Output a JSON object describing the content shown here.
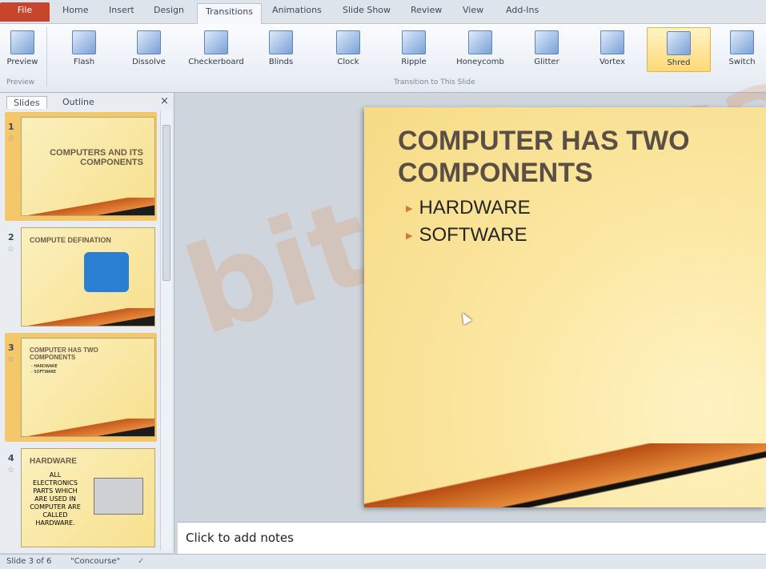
{
  "tabs": [
    "File",
    "Home",
    "Insert",
    "Design",
    "Transitions",
    "Animations",
    "Slide Show",
    "Review",
    "View",
    "Add-Ins"
  ],
  "active_tab": "Transitions",
  "ribbon": {
    "preview_label": "Preview",
    "preview_group": "Preview",
    "transition_group": "Transition to This Slide",
    "transitions": [
      "Flash",
      "Dissolve",
      "Checkerboard",
      "Blinds",
      "Clock",
      "Ripple",
      "Honeycomb",
      "Glitter",
      "Vortex",
      "Shred",
      "Switch"
    ],
    "selected_transition": "Shred"
  },
  "pane": {
    "tabs": [
      "Slides",
      "Outline"
    ],
    "close": "×"
  },
  "thumbs": [
    {
      "num": "1",
      "title": "COMPUTERS AND ITS COMPONENTS"
    },
    {
      "num": "2",
      "title": "COMPUTE DEFINATION"
    },
    {
      "num": "3",
      "title": "COMPUTER HAS TWO COMPONENTS",
      "items": [
        "- HARDWARE",
        "- SOFTWARE"
      ]
    },
    {
      "num": "4",
      "title": "HARDWARE",
      "body": "ALL ELECTRONICS PARTS WHICH ARE USED IN COMPUTER ARE CALLED HARDWARE."
    }
  ],
  "slide": {
    "title_line1": "COMPUTER HAS TWO",
    "title_line2": "COMPONENTS",
    "bullets": [
      "HARDWARE",
      "SOFTWARE"
    ]
  },
  "notes_placeholder": "Click to add notes",
  "status": {
    "slide_of": "Slide 3 of 6",
    "theme": "\"Concourse\""
  },
  "colors": {
    "file_tab": "#c6452b",
    "selected_transition": "#ffd977",
    "slide_bg": "#f6db86",
    "title": "#5b4e44"
  }
}
